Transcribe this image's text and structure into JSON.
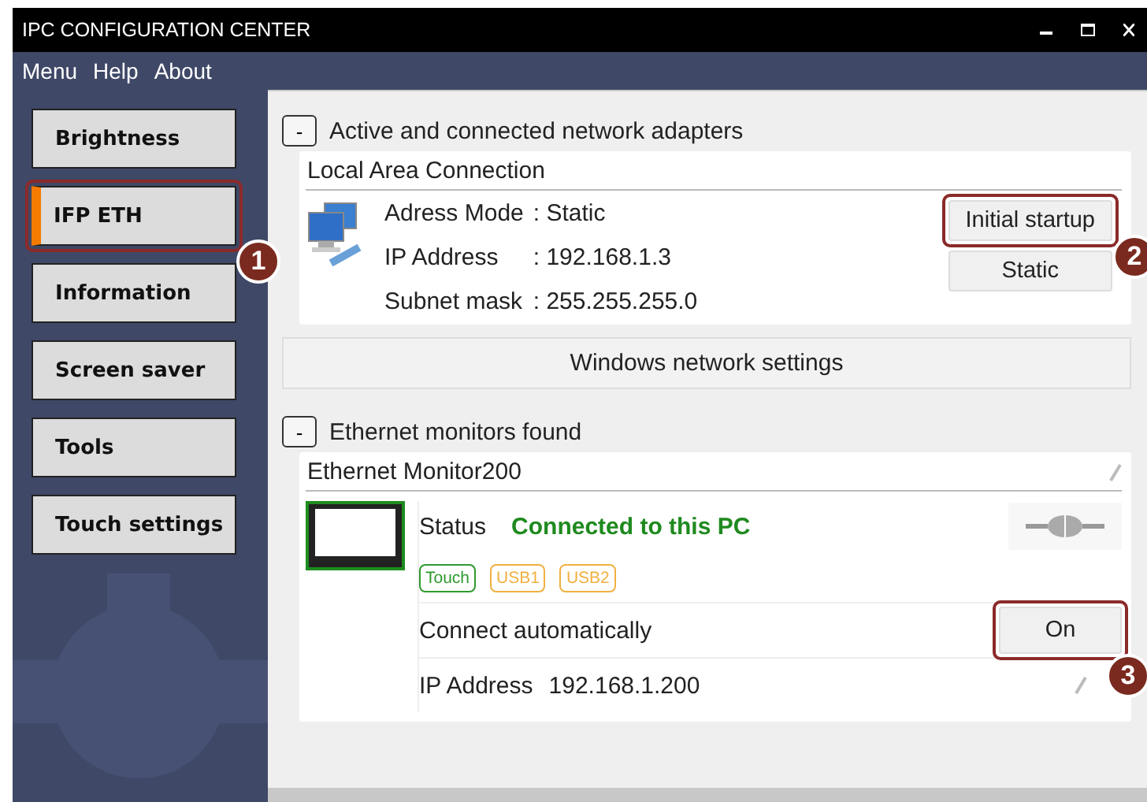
{
  "window": {
    "title": "IPC CONFIGURATION CENTER"
  },
  "menu": [
    "Menu",
    "Help",
    "About"
  ],
  "sidebar": {
    "items": [
      {
        "label": "Brightness",
        "selected": false
      },
      {
        "label": "IFP ETH",
        "selected": true,
        "callout": "1"
      },
      {
        "label": "Information",
        "selected": false
      },
      {
        "label": "Screen saver",
        "selected": false
      },
      {
        "label": "Tools",
        "selected": false
      },
      {
        "label": "Touch settings",
        "selected": false
      }
    ]
  },
  "adapters": {
    "toggle": "-",
    "title": "Active and connected network adapters",
    "expanded": true,
    "connection": {
      "name": "Local Area Connection",
      "fields": [
        {
          "label": "Adress Mode",
          "value": ": Static"
        },
        {
          "label": "IP Address",
          "value": ": 192.168.1.3"
        },
        {
          "label": "Subnet mask",
          "value": ": 255.255.255.0"
        }
      ],
      "buttons": [
        {
          "label": "Initial startup",
          "callout": "2"
        },
        {
          "label": "Static"
        }
      ]
    },
    "network_button": "Windows network settings"
  },
  "monitors": {
    "toggle": "-",
    "title": "Ethernet monitors found",
    "expanded": true,
    "monitor": {
      "name": "Ethernet Monitor200",
      "status_label": "Status",
      "status": "Connected to this PC",
      "connected": true,
      "tags": [
        {
          "label": "Touch",
          "color": "#2e9a2e"
        },
        {
          "label": "USB1",
          "color": "#f0b040"
        },
        {
          "label": "USB2",
          "color": "#f0b040"
        }
      ],
      "auto_connect_label": "Connect automatically",
      "auto_connect_button": {
        "label": "On",
        "callout": "3"
      },
      "ip_label": "IP Address",
      "ip_value": "192.168.1.200"
    }
  }
}
